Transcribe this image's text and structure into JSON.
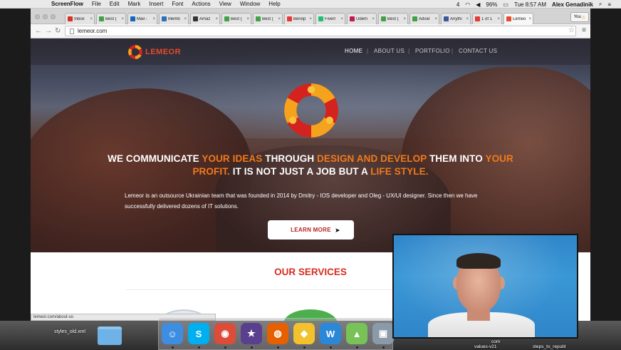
{
  "menubar": {
    "app_name": "ScreenFlow",
    "menus": [
      "File",
      "Edit",
      "Mark",
      "Insert",
      "Font",
      "Actions",
      "View",
      "Window",
      "Help"
    ],
    "battery": "96%",
    "clock": "Tue 8:57 AM",
    "user": "Alex Genadinik",
    "status_count": "4"
  },
  "browser": {
    "tabs": [
      {
        "label": "Inbox",
        "color": "#d93025"
      },
      {
        "label": "Best (",
        "color": "#43a047"
      },
      {
        "label": "Mail -",
        "color": "#1565c0"
      },
      {
        "label": "Memb",
        "color": "#2c6fb7"
      },
      {
        "label": "Amaz",
        "color": "#333333"
      },
      {
        "label": "Best (",
        "color": "#43a047"
      },
      {
        "label": "Best (",
        "color": "#43a047"
      },
      {
        "label": "Benop",
        "color": "#e53935"
      },
      {
        "label": "Fiverr",
        "color": "#1dbf73"
      },
      {
        "label": "Udem",
        "color": "#c2185b"
      },
      {
        "label": "Best (",
        "color": "#43a047"
      },
      {
        "label": "Advar",
        "color": "#43a047"
      },
      {
        "label": "Anythi",
        "color": "#3b5998"
      },
      {
        "label": "1 of 1",
        "color": "#e53935"
      },
      {
        "label": "Lemeo",
        "color": "#e64a2a"
      }
    ],
    "profile_button": "You",
    "url": "lemeor.com",
    "status_url": "lemeor.com/about-us"
  },
  "site": {
    "logo_text": "LEMEOR",
    "nav": [
      "HOME",
      "ABOUT US",
      "PORTFOLIO",
      "CONTACT US"
    ],
    "headline": {
      "p1": "WE COMMUNICATE ",
      "p2": "YOUR IDEAS",
      "p3": " THROUGH ",
      "p4": "DESIGN AND DEVELOP",
      "p5": " THEM INTO ",
      "p6": "YOUR PROFIT.",
      "p7": " IT IS NOT JUST A JOB BUT A ",
      "p8": "LIFE STYLE."
    },
    "description": "Lemeor is an outsource Ukrainian team that was founded in 2014 by Dmitry - IOS developer and Oleg - UX/UI designer. Since then we have successfully delivered dozens of IT solutions.",
    "cta_label": "LEARN MORE",
    "services_title": "OUR SERVICES"
  },
  "desktop": {
    "file_label": "styles_old.xml",
    "pip_labels": [
      "com",
      "values-v21",
      "steps_to_republ"
    ]
  },
  "dock": {
    "apps": [
      {
        "name": "finder",
        "color": "#3d8ee0",
        "glyph": "☺"
      },
      {
        "name": "skype",
        "color": "#00aff0",
        "glyph": "S"
      },
      {
        "name": "chrome",
        "color": "#dd4b39",
        "glyph": "◉"
      },
      {
        "name": "imovie",
        "color": "#5a3f8f",
        "glyph": "★"
      },
      {
        "name": "firefox",
        "color": "#e66000",
        "glyph": "◍"
      },
      {
        "name": "cyberduck",
        "color": "#f2c12e",
        "glyph": "◆"
      },
      {
        "name": "wunderlist",
        "color": "#2b88d9",
        "glyph": "W"
      },
      {
        "name": "android-studio",
        "color": "#78c257",
        "glyph": "▲"
      },
      {
        "name": "preview",
        "color": "#8a9aa8",
        "glyph": "▣"
      }
    ]
  }
}
